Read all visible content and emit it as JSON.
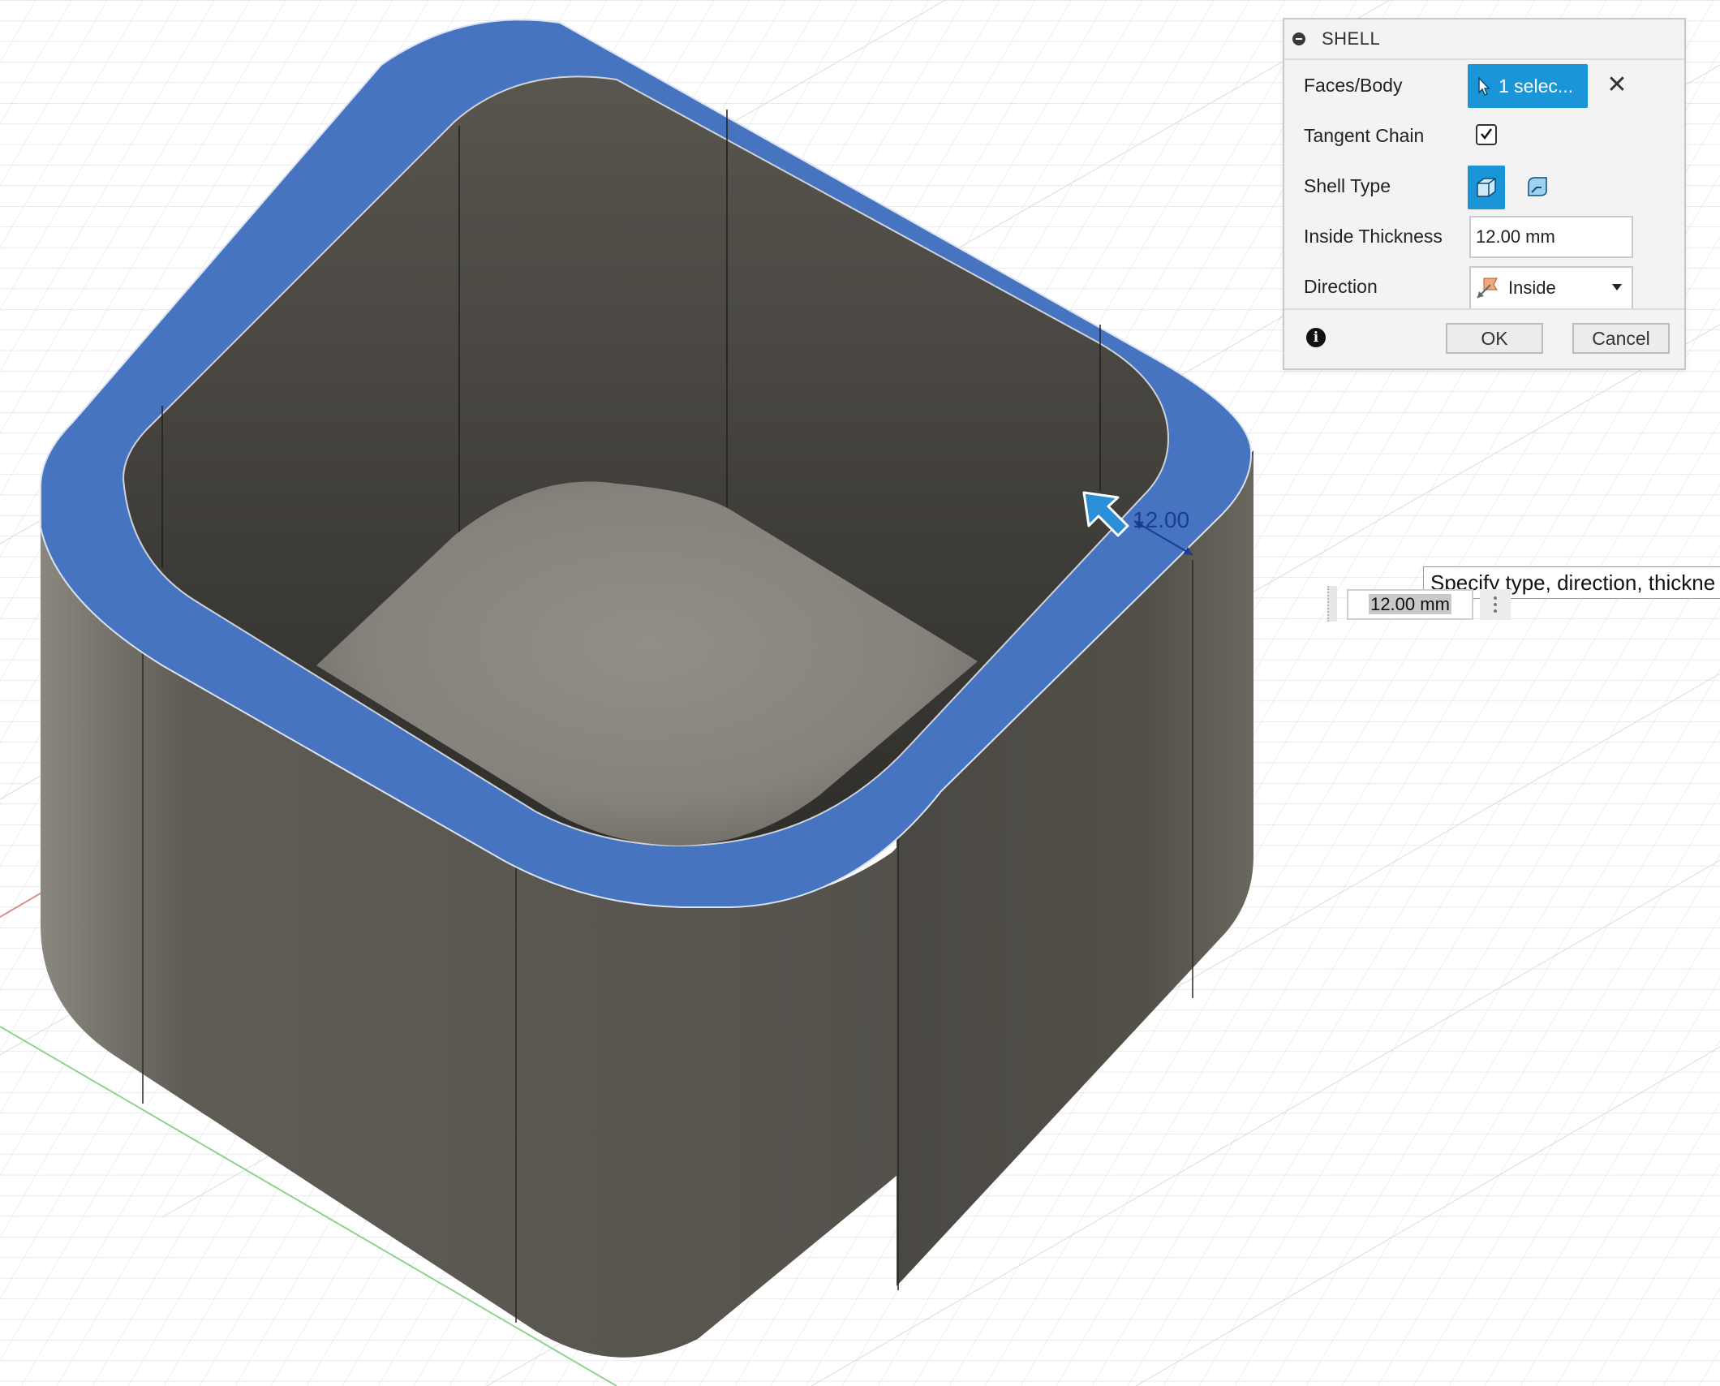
{
  "dialog": {
    "title": "SHELL",
    "faces_body": {
      "label": "Faces/Body",
      "selection": "1 selec..."
    },
    "tangent_chain": {
      "label": "Tangent Chain",
      "checked": true
    },
    "shell_type": {
      "label": "Shell Type",
      "selected": "sharp"
    },
    "inside_thickness": {
      "label": "Inside Thickness",
      "value": "12.00 mm"
    },
    "direction": {
      "label": "Direction",
      "value": "Inside"
    },
    "ok_label": "OK",
    "cancel_label": "Cancel"
  },
  "canvas": {
    "dimension_label": "12.00",
    "tooltip": "Specify type, direction, thickne",
    "thickness_input": "12.00 mm"
  },
  "icons": {
    "collapse": "collapse-icon",
    "select": "select-cursor-icon",
    "clear": "close-icon",
    "info": "info-icon",
    "direction": "direction-arrow-icon",
    "more": "more-vertical-icon"
  },
  "colors": {
    "selection_blue": "#4674c0",
    "accent": "#1a95d8",
    "body_gray": "#58554f"
  }
}
